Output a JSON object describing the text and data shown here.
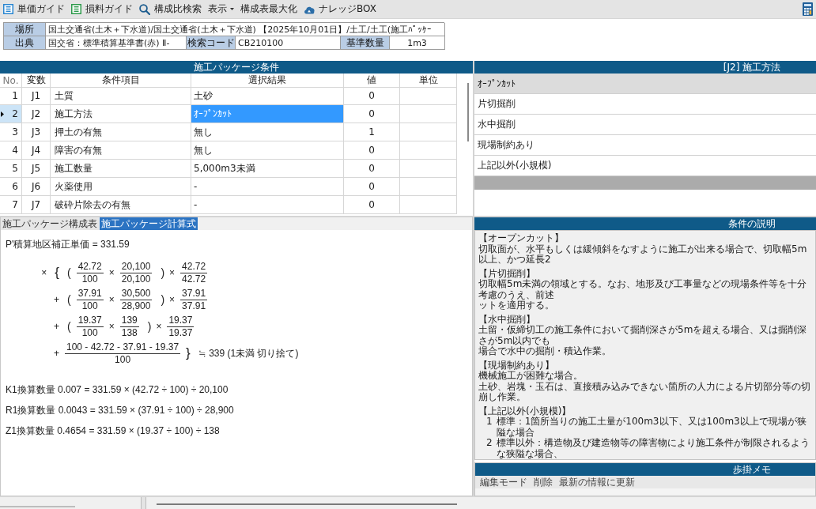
{
  "toolbar": {
    "items": [
      {
        "kind": "tile",
        "label": "単価ガイド",
        "color": "#2a86d0"
      },
      {
        "kind": "tile",
        "label": "損料ガイド",
        "color": "#2e9a4c"
      },
      {
        "kind": "search",
        "label": "構成比検索"
      },
      {
        "kind": "menu",
        "label": "表示"
      },
      {
        "kind": "plain",
        "label": "構成表最大化"
      },
      {
        "kind": "cloud",
        "label": "ナレッジBOX"
      }
    ]
  },
  "info": {
    "location_label": "場所",
    "location": "国土交通省(土木＋下水道)/国土交通省(土木＋下水道) 【2025年10月01日】/土工/土工(施工ﾊﾟｯｹｰ",
    "source_label": "出典",
    "source": "国交省：標準積算基準書(赤) Ⅱ-",
    "code_label": "検索コード",
    "code": "CB210100",
    "base_qty_label": "基準数量",
    "base_qty": "1m3"
  },
  "conditions": {
    "title": "施工パッケージ条件",
    "columns": [
      "No.",
      "変数",
      "条件項目",
      "選択結果",
      "値",
      "単位"
    ],
    "rows": [
      {
        "no": "1",
        "var": "J1",
        "item": "土質",
        "result": "土砂",
        "value": "0",
        "selected": false
      },
      {
        "no": "2",
        "var": "J2",
        "item": "施工方法",
        "result": "ｵｰﾌﾟﾝｶｯﾄ",
        "value": "0",
        "selected": true
      },
      {
        "no": "3",
        "var": "J3",
        "item": "押土の有無",
        "result": "無し",
        "value": "1",
        "selected": false
      },
      {
        "no": "4",
        "var": "J4",
        "item": "障害の有無",
        "result": "無し",
        "value": "0",
        "selected": false
      },
      {
        "no": "5",
        "var": "J5",
        "item": "施工数量",
        "result": "5,000m3未満",
        "value": "0",
        "selected": false
      },
      {
        "no": "6",
        "var": "J6",
        "item": "火薬使用",
        "result": "-",
        "value": "0",
        "selected": false
      },
      {
        "no": "7",
        "var": "J7",
        "item": "破砕片除去の有無",
        "result": "-",
        "value": "0",
        "selected": false
      }
    ]
  },
  "options": {
    "title": "[J2] 施工方法",
    "items": [
      {
        "label": "ｵｰﾌﾟﾝｶｯﾄ",
        "selected": true
      },
      {
        "label": "片切掘削",
        "selected": false
      },
      {
        "label": "水中掘削",
        "selected": false
      },
      {
        "label": "現場制約あり",
        "selected": false
      },
      {
        "label": "上記以外(小規模)",
        "selected": false
      }
    ]
  },
  "tabs": [
    {
      "label": "施工パッケージ構成表",
      "selected": false
    },
    {
      "label": "施工パッケージ計算式",
      "selected": true
    }
  ],
  "formula": {
    "heading": "P'積算地区補正単価 = 331.59",
    "multiplier": "×",
    "brace_open": "{",
    "terms": [
      {
        "kind": "ratio",
        "open": "(",
        "a": {
          "num": "42.72",
          "den": "100"
        },
        "times": "×",
        "b": {
          "num": "20,100",
          "den": "20,100"
        },
        "close": ")",
        "times_outer": "×",
        "c": {
          "num": "42.72",
          "den": "42.72"
        }
      },
      {
        "kind": "ratio",
        "op": "+",
        "open": "(",
        "a": {
          "num": "37.91",
          "den": "100"
        },
        "times": "×",
        "b": {
          "num": "30,500",
          "den": "28,900"
        },
        "close": ")",
        "times_outer": "×",
        "c": {
          "num": "37.91",
          "den": "37.91"
        }
      },
      {
        "kind": "ratio",
        "op": "+",
        "open": "(",
        "a": {
          "num": "19.37",
          "den": "100"
        },
        "times": "×",
        "b": {
          "num": "139",
          "den": "138"
        },
        "close": ")",
        "times_outer": "×",
        "c": {
          "num": "19.37",
          "den": "19.37"
        }
      },
      {
        "kind": "remainder",
        "op": "+",
        "a": {
          "num": "100 - 42.72 - 37.91 - 19.37",
          "den": "100"
        }
      }
    ],
    "brace_close": "}",
    "result": "≒ 339 (1未満 切り捨て)"
  },
  "conversions": [
    "K1換算数量 0.007 = 331.59 × (42.72 ÷ 100) ÷ 20,100",
    "R1換算数量 0.0043 = 331.59 × (37.91 ÷ 100) ÷ 28,900",
    "Z1換算数量 0.4654 = 331.59 × (19.37 ÷ 100) ÷ 138"
  ],
  "description": {
    "title": "条件の説明",
    "sections": [
      {
        "heading": "【オープンカット】",
        "lines": [
          "切取面が、水平もしくは緩傾斜をなすように施工が出来る場合で、切取幅5m以上、かつ延長2"
        ]
      },
      {
        "heading": "【片切掘削】",
        "lines": [
          "切取幅5m未満の領域とする。なお、地形及び工事量などの現場条件等を十分考慮のうえ、前述",
          "ットを適用する。"
        ]
      },
      {
        "heading": "【水中掘削】",
        "lines": [
          "土留・仮締切工の施工条件において掘削深さが5mを超える場合、又は掘削深さが5m以内でも",
          "場合で水中の掘削・積込作業。"
        ]
      },
      {
        "heading": "【現場制約あり】",
        "lines": [
          "機械施工が困難な場合。",
          "土砂、岩塊・玉石は、直接積み込みできない箇所の人力による片切部分等の切崩し作業。"
        ]
      },
      {
        "heading": "【上記以外(小規模)】",
        "items": [
          {
            "number": "1",
            "text": "標準：1箇所当りの施工土量が100m3以下、又は100m3以上で現場が狭隘な場合"
          },
          {
            "number": "2",
            "text": "標準以外：構造物及び建造物等の障害物により施工条件が制限されるような狭隘な場合、"
          }
        ]
      }
    ]
  },
  "memo": {
    "title": "歩掛メモ",
    "actions": [
      "編集モード",
      "削除",
      "最新の情報に更新"
    ]
  }
}
